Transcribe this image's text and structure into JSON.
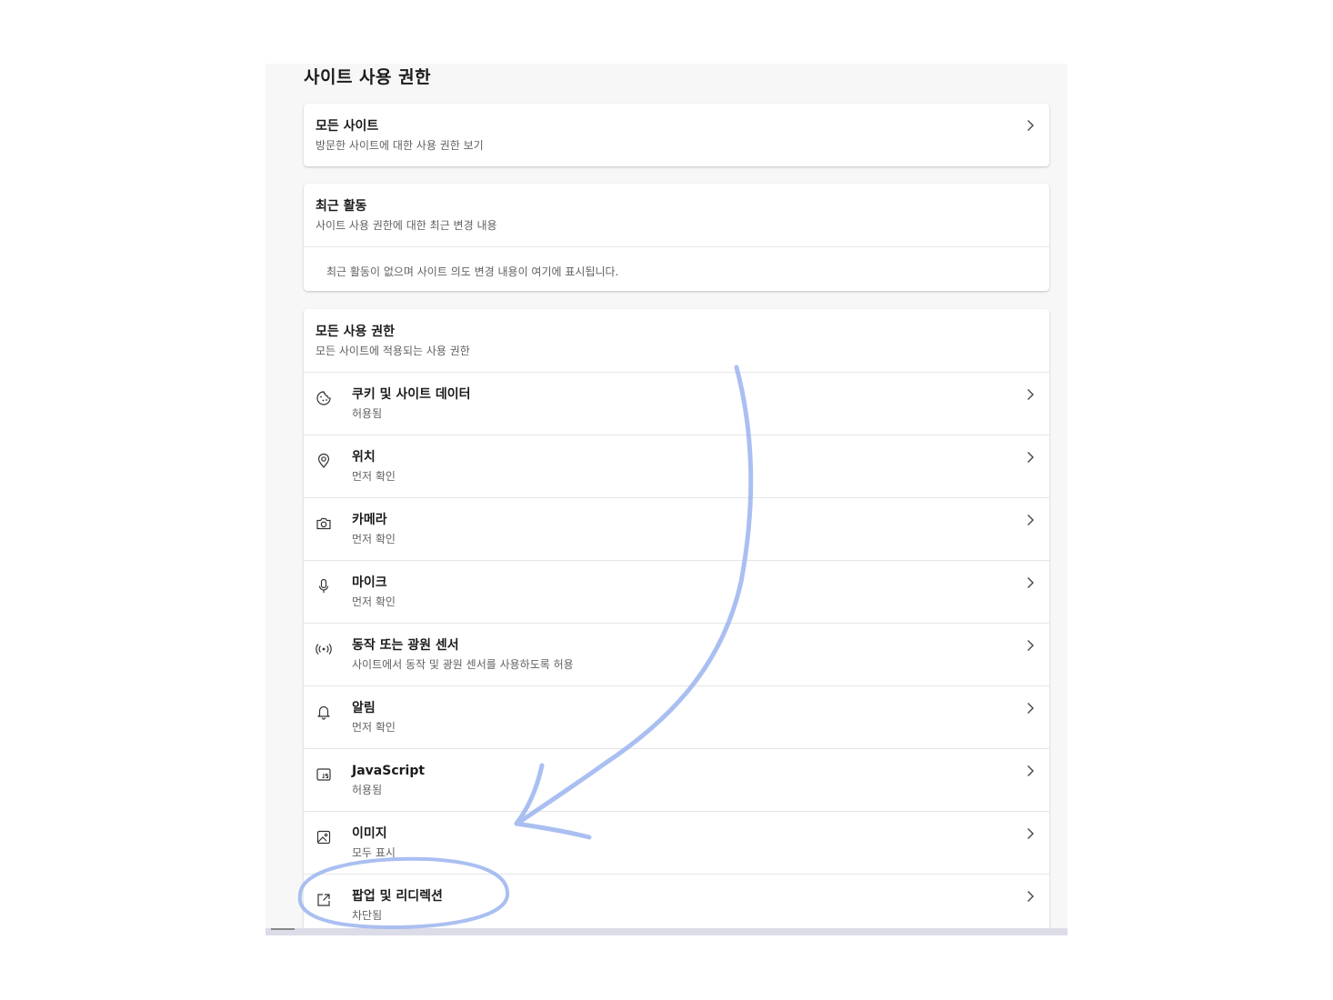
{
  "page": {
    "title": "사이트 사용 권한"
  },
  "all_sites": {
    "title": "모든 사이트",
    "subtitle": "방문한 사이트에 대한 사용 권한 보기"
  },
  "recent_activity": {
    "title": "최근 활동",
    "subtitle": "사이트 사용 권한에 대한 최근 변경 내용",
    "empty_message": "최근 활동이 없으며 사이트 의도 변경 내용이 여기에 표시됩니다."
  },
  "all_permissions": {
    "title": "모든 사용 권한",
    "subtitle": "모든 사이트에 적용되는 사용 권한",
    "items": [
      {
        "icon": "cookie-icon",
        "label": "쿠키 및 사이트 데이터",
        "status": "허용됨"
      },
      {
        "icon": "location-pin-icon",
        "label": "위치",
        "status": "먼저 확인"
      },
      {
        "icon": "camera-icon",
        "label": "카메라",
        "status": "먼저 확인"
      },
      {
        "icon": "microphone-icon",
        "label": "마이크",
        "status": "먼저 확인"
      },
      {
        "icon": "motion-sensor-icon",
        "label": "동작 또는 광원 센서",
        "status": "사이트에서 동작 및 광원 센서를 사용하도록 허용"
      },
      {
        "icon": "bell-icon",
        "label": "알림",
        "status": "먼저 확인"
      },
      {
        "icon": "javascript-icon",
        "label": "JavaScript",
        "status": "허용됨"
      },
      {
        "icon": "image-icon",
        "label": "이미지",
        "status": "모두 표시"
      },
      {
        "icon": "popup-redirect-icon",
        "label": "팝업 및 리디렉션",
        "status": "차단됨"
      }
    ]
  },
  "colors": {
    "page_bg": "#f7f7f7",
    "card_bg": "#ffffff",
    "annotation_stroke": "#9bb4ef"
  }
}
